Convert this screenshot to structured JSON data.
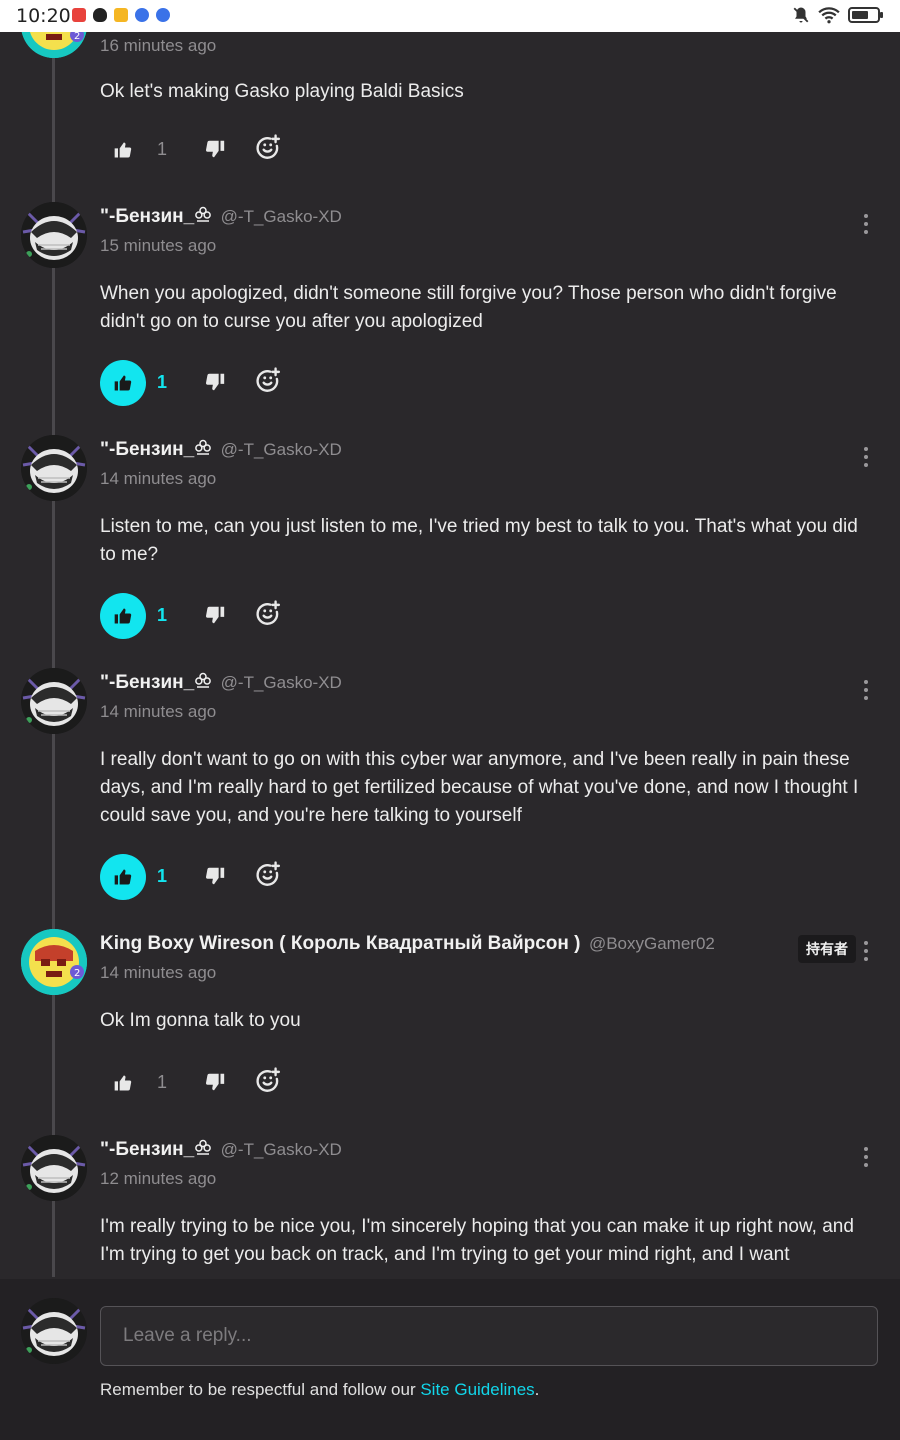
{
  "statusbar": {
    "time": "10:20"
  },
  "comments": [
    {
      "author": "",
      "handle": "",
      "time": "16 minutes ago",
      "text": "Ok let's making Gasko playing Baldi Basics",
      "likes": "1",
      "liked": false
    },
    {
      "author": "\"-Бензин_",
      "handle": "@-T_Gasko-XD",
      "time": "15 minutes ago",
      "text": "When you apologized, didn't someone still forgive you? Those person who didn't forgive didn't go on to curse you after you apologized",
      "likes": "1",
      "liked": true
    },
    {
      "author": "\"-Бензин_",
      "handle": "@-T_Gasko-XD",
      "time": "14 minutes ago",
      "text": "Listen to me, can you just listen to me, I've tried my best to talk to you. That's what you did to me?",
      "likes": "1",
      "liked": true
    },
    {
      "author": "\"-Бензин_",
      "handle": "@-T_Gasko-XD",
      "time": "14 minutes ago",
      "text": "I really don't want to go on with this cyber war anymore, and I've been really in pain these days, and I'm really hard to get fertilized because of what you've done, and now I thought I could save you, and you're here talking to yourself",
      "likes": "1",
      "liked": true
    },
    {
      "author": "King Boxy Wireson ( Король Квадратный Вайрсон )",
      "handle": "@BoxyGamer02",
      "badge": "持有者",
      "time": "14 minutes ago",
      "text": "Ok Im gonna talk to you",
      "likes": "1",
      "liked": false
    },
    {
      "author": "\"-Бензин_",
      "handle": "@-T_Gasko-XD",
      "time": "12 minutes ago",
      "text": "I'm really trying to be nice you, I'm sincerely hoping that you can make it up right now, and I'm trying to get you back on track, and I'm trying to get your mind right, and I want",
      "likes": "",
      "liked": false
    }
  ],
  "reply": {
    "placeholder": "Leave a reply..."
  },
  "guidelines": {
    "text": "Remember to be respectful and follow our ",
    "link": "Site Guidelines",
    "end": "."
  },
  "colors": {
    "accent": "#12e5ef",
    "background": "#2a282b",
    "footer": "#232124"
  }
}
